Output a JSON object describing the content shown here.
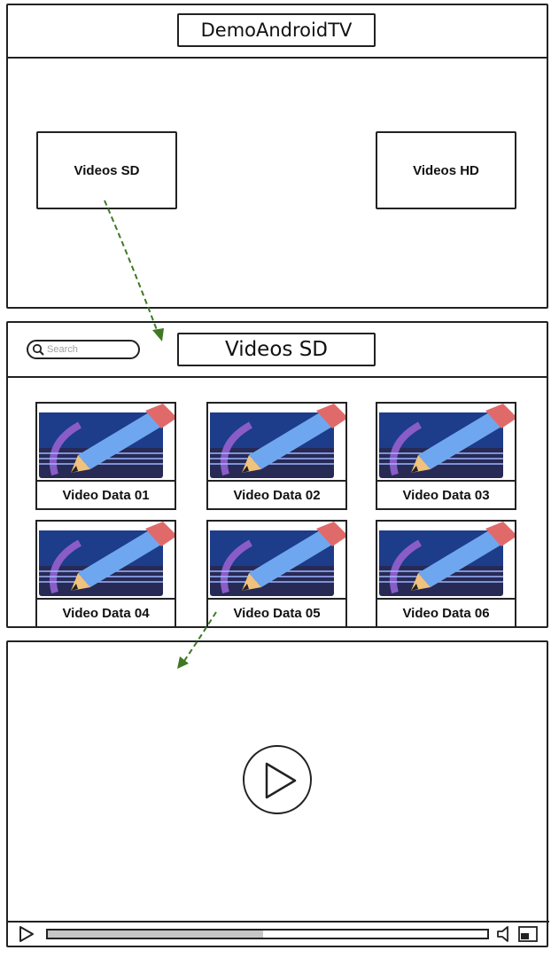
{
  "screen1": {
    "app_title": "DemoAndroidTV",
    "buttons": [
      {
        "label": "Videos SD"
      },
      {
        "label": "Videos HD"
      }
    ]
  },
  "screen2": {
    "title": "Videos SD",
    "search": {
      "placeholder": "Search",
      "icon": "search-icon"
    },
    "videos": [
      {
        "label": "Video Data 01"
      },
      {
        "label": "Video Data 02"
      },
      {
        "label": "Video Data 03"
      },
      {
        "label": "Video Data 04"
      },
      {
        "label": "Video Data 05"
      },
      {
        "label": "Video Data 06"
      }
    ],
    "thumbnail_icon": "pencil-drawing-icon"
  },
  "screen3": {
    "play_icon": "play-icon",
    "progress_fraction": 0.49,
    "controls": [
      "play-icon",
      "volume-icon",
      "fullscreen-icon"
    ]
  },
  "colors": {
    "flow_arrow": "#3e7a22",
    "stroke": "#222222",
    "thumb_bg": "#262a55",
    "progress_fill": "#c6c6c6"
  }
}
